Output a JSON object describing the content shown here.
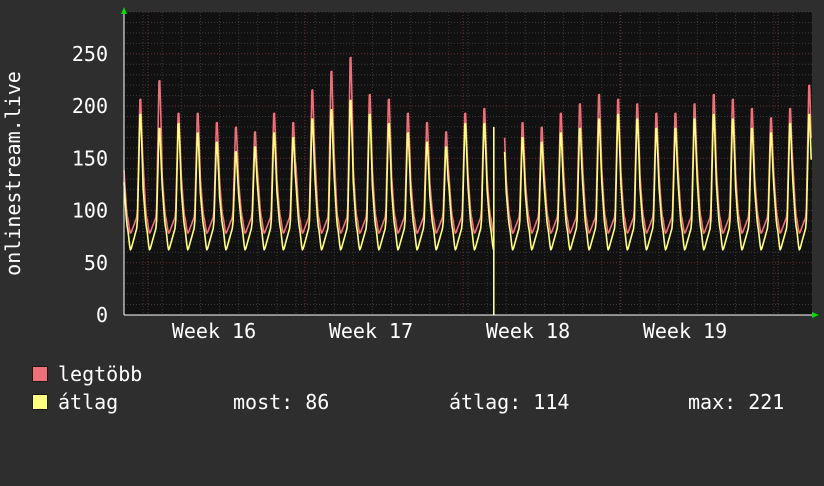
{
  "chart_data": {
    "type": "line",
    "ylabel": "onlinestream.live",
    "ylim": [
      0,
      290
    ],
    "yticks": [
      0,
      50,
      100,
      150,
      200,
      250
    ],
    "x_tick_labels": [
      "Week 16",
      "Week 17",
      "Week 18",
      "Week 19"
    ],
    "grid": true,
    "series": [
      {
        "name": "legtöbb",
        "color": "#f0707a",
        "daily_peaks": [
          220,
          240,
          205,
          205,
          195,
          190,
          185,
          205,
          195,
          230,
          250,
          265,
          225,
          220,
          205,
          195,
          185,
          205,
          210,
          200,
          195,
          190,
          205,
          215,
          225,
          220,
          215,
          205,
          205,
          215,
          225,
          220,
          210,
          200,
          210,
          235
        ]
      },
      {
        "name": "átlag",
        "color": "#ffff80",
        "daily_peaks": [
          205,
          190,
          195,
          185,
          175,
          165,
          170,
          185,
          180,
          200,
          210,
          220,
          205,
          195,
          185,
          175,
          170,
          195,
          195,
          185,
          180,
          175,
          185,
          190,
          200,
          205,
          200,
          190,
          190,
          200,
          205,
          200,
          190,
          185,
          195,
          205
        ]
      }
    ],
    "gap_note": "no data between Week 17 and Week 18 dropout"
  },
  "legend": {
    "max_label": "legtöbb",
    "avg_label": "átlag",
    "max_color": "#f0707a",
    "avg_color": "#ffff80"
  },
  "stats": {
    "current": "most: 86",
    "average": "átlag: 114",
    "maximum": "max: 221"
  }
}
